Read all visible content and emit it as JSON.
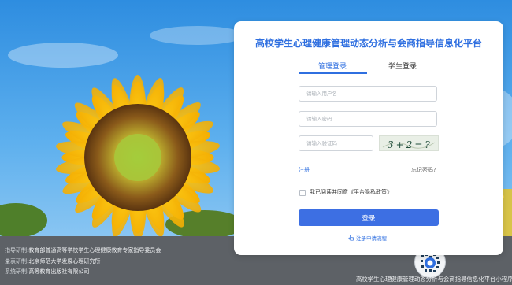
{
  "card": {
    "title": "高校学生心理健康管理动态分析与会商指导信息化平台",
    "tabs": [
      {
        "label": "管理登录",
        "active": true
      },
      {
        "label": "学生登录",
        "active": false
      }
    ],
    "username_placeholder": "请输入用户名",
    "password_placeholder": "请输入密码",
    "captcha_placeholder": "请输入验证码",
    "captcha_text": "3+2=?",
    "register_label": "注册",
    "forgot_label": "忘记密码?",
    "agree_prefix": "我已阅读并同意",
    "agree_policy": "《平台隐私政策》",
    "login_label": "登录",
    "apply_label": "注册申请流程"
  },
  "footer": {
    "lines": [
      {
        "key": "指导研制:",
        "value": "教育部普通高等学校学生心理健康教育专家指导委员会"
      },
      {
        "key": "量表研制:",
        "value": "北京师范大学发展心理研究所"
      },
      {
        "key": "系统研制:",
        "value": "高等教育出版社有限公司"
      }
    ],
    "miniprogram_caption": "高校学生心理健康管理动态分析与会商指导信息化平台小程序"
  },
  "colors": {
    "accent": "#2f6fe0",
    "button": "#3d6fe3",
    "footer_bg": "#5d6166"
  },
  "icons": {
    "apply": "hand-pointer-icon",
    "qr": "miniprogram-code-icon"
  }
}
